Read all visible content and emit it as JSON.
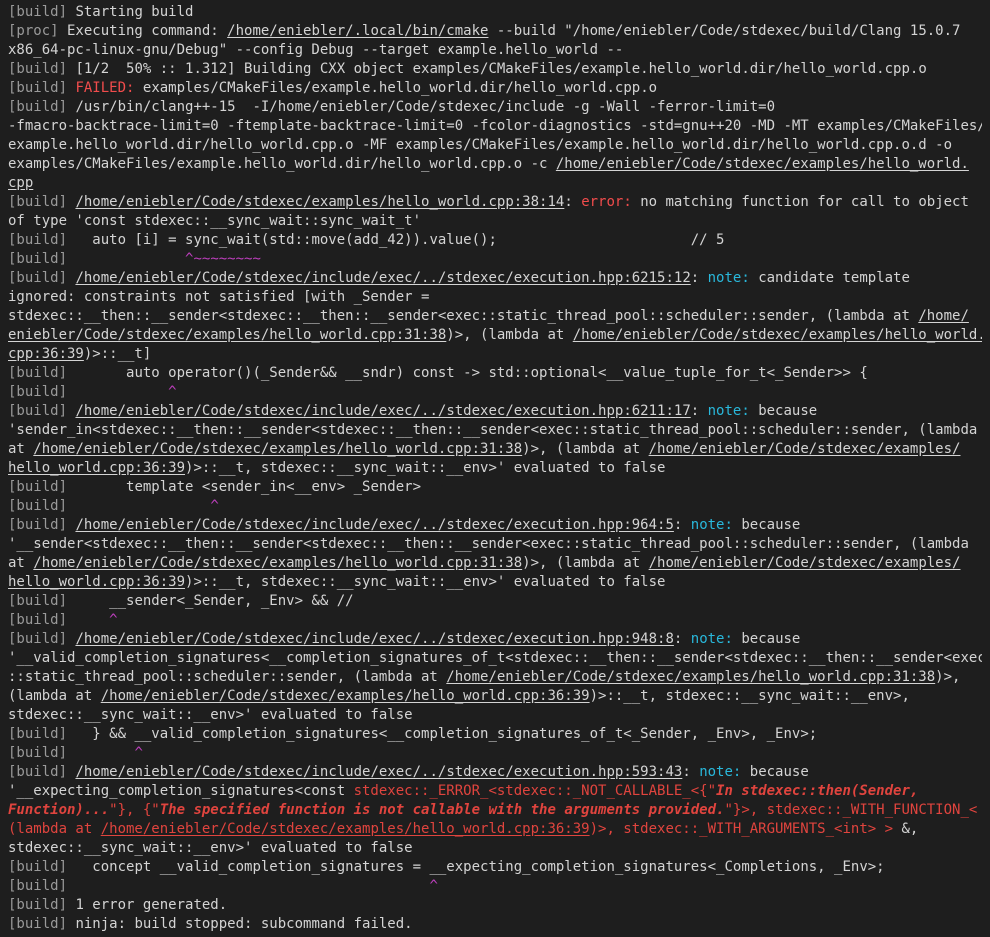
{
  "lines": [
    [
      [
        "pf",
        "[build]"
      ],
      [
        "t",
        " Starting build"
      ]
    ],
    [
      [
        "pf",
        "[proc]"
      ],
      [
        "t",
        " Executing command: "
      ],
      [
        "u",
        "/home/eniebler/.local/bin/cmake"
      ],
      [
        "t",
        " --build \"/home/eniebler/Code/stdexec/build/Clang 15.0.7"
      ]
    ],
    [
      [
        "t",
        "x86_64-pc-linux-gnu/Debug\" --config Debug --target example.hello_world --"
      ]
    ],
    [
      [
        "pf",
        "[build]"
      ],
      [
        "t",
        " [1/2  50% :: 1.312] Building CXX object examples/CMakeFiles/example.hello_world.dir/hello_world.cpp.o"
      ]
    ],
    [
      [
        "pf",
        "[build]"
      ],
      [
        "t",
        " "
      ],
      [
        "err",
        "FAILED:"
      ],
      [
        "t",
        " examples/CMakeFiles/example.hello_world.dir/hello_world.cpp.o"
      ]
    ],
    [
      [
        "pf",
        "[build]"
      ],
      [
        "t",
        " /usr/bin/clang++-15  -I/home/eniebler/Code/stdexec/include -g -Wall -ferror-limit=0"
      ]
    ],
    [
      [
        "t",
        "-fmacro-backtrace-limit=0 -ftemplate-backtrace-limit=0 -fcolor-diagnostics -std=gnu++20 -MD -MT examples/CMakeFiles/"
      ]
    ],
    [
      [
        "t",
        "example.hello_world.dir/hello_world.cpp.o -MF examples/CMakeFiles/example.hello_world.dir/hello_world.cpp.o.d -o"
      ]
    ],
    [
      [
        "t",
        "examples/CMakeFiles/example.hello_world.dir/hello_world.cpp.o -c "
      ],
      [
        "u",
        "/home/eniebler/Code/stdexec/examples/hello_world."
      ]
    ],
    [
      [
        "u",
        "cpp"
      ]
    ],
    [
      [
        "pf",
        "[build]"
      ],
      [
        "t",
        " "
      ],
      [
        "u",
        "/home/eniebler/Code/stdexec/examples/hello_world.cpp:38:14"
      ],
      [
        "t",
        ": "
      ],
      [
        "err",
        "error:"
      ],
      [
        "t",
        " no matching function for call to object"
      ]
    ],
    [
      [
        "t",
        "of type 'const stdexec::__sync_wait::sync_wait_t'"
      ]
    ],
    [
      [
        "pf",
        "[build]"
      ],
      [
        "t",
        "   auto [i] = sync_wait(std::move(add_42)).value();                       // 5"
      ]
    ],
    [
      [
        "pf",
        "[build]"
      ],
      [
        "t",
        "              "
      ],
      [
        "caret",
        "^~~~~~~~~"
      ]
    ],
    [
      [
        "pf",
        "[build]"
      ],
      [
        "t",
        " "
      ],
      [
        "u",
        "/home/eniebler/Code/stdexec/include/exec/../stdexec/execution.hpp:6215:12"
      ],
      [
        "t",
        ": "
      ],
      [
        "note",
        "note:"
      ],
      [
        "t",
        " candidate template"
      ]
    ],
    [
      [
        "t",
        "ignored: constraints not satisfied [with _Sender ="
      ]
    ],
    [
      [
        "t",
        "stdexec::__then::__sender<stdexec::__then::__sender<exec::static_thread_pool::scheduler::sender, (lambda at "
      ],
      [
        "u",
        "/home/"
      ]
    ],
    [
      [
        "u",
        "eniebler/Code/stdexec/examples/hello_world.cpp:31:38"
      ],
      [
        "t",
        ")>, (lambda at "
      ],
      [
        "u",
        "/home/eniebler/Code/stdexec/examples/hello_world."
      ]
    ],
    [
      [
        "u",
        "cpp:36:39"
      ],
      [
        "t",
        ")>::__t]"
      ]
    ],
    [
      [
        "pf",
        "[build]"
      ],
      [
        "t",
        "       auto operator()(_Sender&& __sndr) const -> std::optional<__value_tuple_for_t<_Sender>> {"
      ]
    ],
    [
      [
        "pf",
        "[build]"
      ],
      [
        "t",
        "            "
      ],
      [
        "caret",
        "^"
      ]
    ],
    [
      [
        "pf",
        "[build]"
      ],
      [
        "t",
        " "
      ],
      [
        "u",
        "/home/eniebler/Code/stdexec/include/exec/../stdexec/execution.hpp:6211:17"
      ],
      [
        "t",
        ": "
      ],
      [
        "note",
        "note:"
      ],
      [
        "t",
        " because"
      ]
    ],
    [
      [
        "t",
        "'sender_in<stdexec::__then::__sender<stdexec::__then::__sender<exec::static_thread_pool::scheduler::sender, (lambda"
      ]
    ],
    [
      [
        "t",
        "at "
      ],
      [
        "u",
        "/home/eniebler/Code/stdexec/examples/hello_world.cpp:31:38"
      ],
      [
        "t",
        ")>, (lambda at "
      ],
      [
        "u",
        "/home/eniebler/Code/stdexec/examples/"
      ]
    ],
    [
      [
        "u",
        "hello_world.cpp:36:39"
      ],
      [
        "t",
        ")>::__t, stdexec::__sync_wait::__env>' evaluated to false"
      ]
    ],
    [
      [
        "pf",
        "[build]"
      ],
      [
        "t",
        "       template <sender_in<__env> _Sender>"
      ]
    ],
    [
      [
        "pf",
        "[build]"
      ],
      [
        "t",
        "                 "
      ],
      [
        "caret",
        "^"
      ]
    ],
    [
      [
        "pf",
        "[build]"
      ],
      [
        "t",
        " "
      ],
      [
        "u",
        "/home/eniebler/Code/stdexec/include/exec/../stdexec/execution.hpp:964:5"
      ],
      [
        "t",
        ": "
      ],
      [
        "note",
        "note:"
      ],
      [
        "t",
        " because"
      ]
    ],
    [
      [
        "t",
        "'__sender<stdexec::__then::__sender<stdexec::__then::__sender<exec::static_thread_pool::scheduler::sender, (lambda"
      ]
    ],
    [
      [
        "t",
        "at "
      ],
      [
        "u",
        "/home/eniebler/Code/stdexec/examples/hello_world.cpp:31:38"
      ],
      [
        "t",
        ")>, (lambda at "
      ],
      [
        "u",
        "/home/eniebler/Code/stdexec/examples/"
      ]
    ],
    [
      [
        "u",
        "hello_world.cpp:36:39"
      ],
      [
        "t",
        ")>::__t, stdexec::__sync_wait::__env>' evaluated to false"
      ]
    ],
    [
      [
        "pf",
        "[build]"
      ],
      [
        "t",
        "     __sender<_Sender, _Env> && //"
      ]
    ],
    [
      [
        "pf",
        "[build]"
      ],
      [
        "t",
        "     "
      ],
      [
        "caret",
        "^"
      ]
    ],
    [
      [
        "pf",
        "[build]"
      ],
      [
        "t",
        " "
      ],
      [
        "u",
        "/home/eniebler/Code/stdexec/include/exec/../stdexec/execution.hpp:948:8"
      ],
      [
        "t",
        ": "
      ],
      [
        "note",
        "note:"
      ],
      [
        "t",
        " because"
      ]
    ],
    [
      [
        "t",
        "'__valid_completion_signatures<__completion_signatures_of_t<stdexec::__then::__sender<stdexec::__then::__sender<exec"
      ]
    ],
    [
      [
        "t",
        "::static_thread_pool::scheduler::sender, (lambda at "
      ],
      [
        "u",
        "/home/eniebler/Code/stdexec/examples/hello_world.cpp:31:38"
      ],
      [
        "t",
        ")>,"
      ]
    ],
    [
      [
        "t",
        "(lambda at "
      ],
      [
        "u",
        "/home/eniebler/Code/stdexec/examples/hello_world.cpp:36:39"
      ],
      [
        "t",
        ")>::__t, stdexec::__sync_wait::__env>,"
      ]
    ],
    [
      [
        "t",
        "stdexec::__sync_wait::__env>' evaluated to false"
      ]
    ],
    [
      [
        "pf",
        "[build]"
      ],
      [
        "t",
        "   } && __valid_completion_signatures<__completion_signatures_of_t<_Sender, _Env>, _Env>;"
      ]
    ],
    [
      [
        "pf",
        "[build]"
      ],
      [
        "t",
        "        "
      ],
      [
        "caret",
        "^"
      ]
    ],
    [
      [
        "pf",
        "[build]"
      ],
      [
        "t",
        " "
      ],
      [
        "u",
        "/home/eniebler/Code/stdexec/include/exec/../stdexec/execution.hpp:593:43"
      ],
      [
        "t",
        ": "
      ],
      [
        "note",
        "note:"
      ],
      [
        "t",
        " because"
      ]
    ],
    [
      [
        "t",
        "'__expecting_completion_signatures<const "
      ],
      [
        "rd",
        "stdexec::_ERROR_<stdexec::_NOT_CALLABLE_<{\""
      ],
      [
        "rdb",
        "In stdexec::then(Sender,"
      ]
    ],
    [
      [
        "rdb",
        "Function)..."
      ],
      [
        "rd",
        "\"}, {\""
      ],
      [
        "rdb",
        "The specified function is not callable with the arguments provided."
      ],
      [
        "rd",
        "\"}>, stdexec::_WITH_FUNCTION_<"
      ]
    ],
    [
      [
        "rd",
        "(lambda at "
      ],
      [
        "u rd",
        "/home/eniebler/Code/stdexec/examples/hello_world.cpp:36:39"
      ],
      [
        "rd",
        ")>, stdexec::_WITH_ARGUMENTS_<int> >"
      ],
      [
        "t",
        " &,"
      ]
    ],
    [
      [
        "t",
        "stdexec::__sync_wait::__env>' evaluated to false"
      ]
    ],
    [
      [
        "pf",
        "[build]"
      ],
      [
        "t",
        "   concept __valid_completion_signatures = __expecting_completion_signatures<_Completions, _Env>;"
      ]
    ],
    [
      [
        "pf",
        "[build]"
      ],
      [
        "t",
        "                                           "
      ],
      [
        "caret",
        "^"
      ]
    ],
    [
      [
        "pf",
        "[build]"
      ],
      [
        "t",
        " 1 error generated."
      ]
    ],
    [
      [
        "pf",
        "[build]"
      ],
      [
        "t",
        " ninja: build stopped: subcommand failed."
      ]
    ]
  ]
}
